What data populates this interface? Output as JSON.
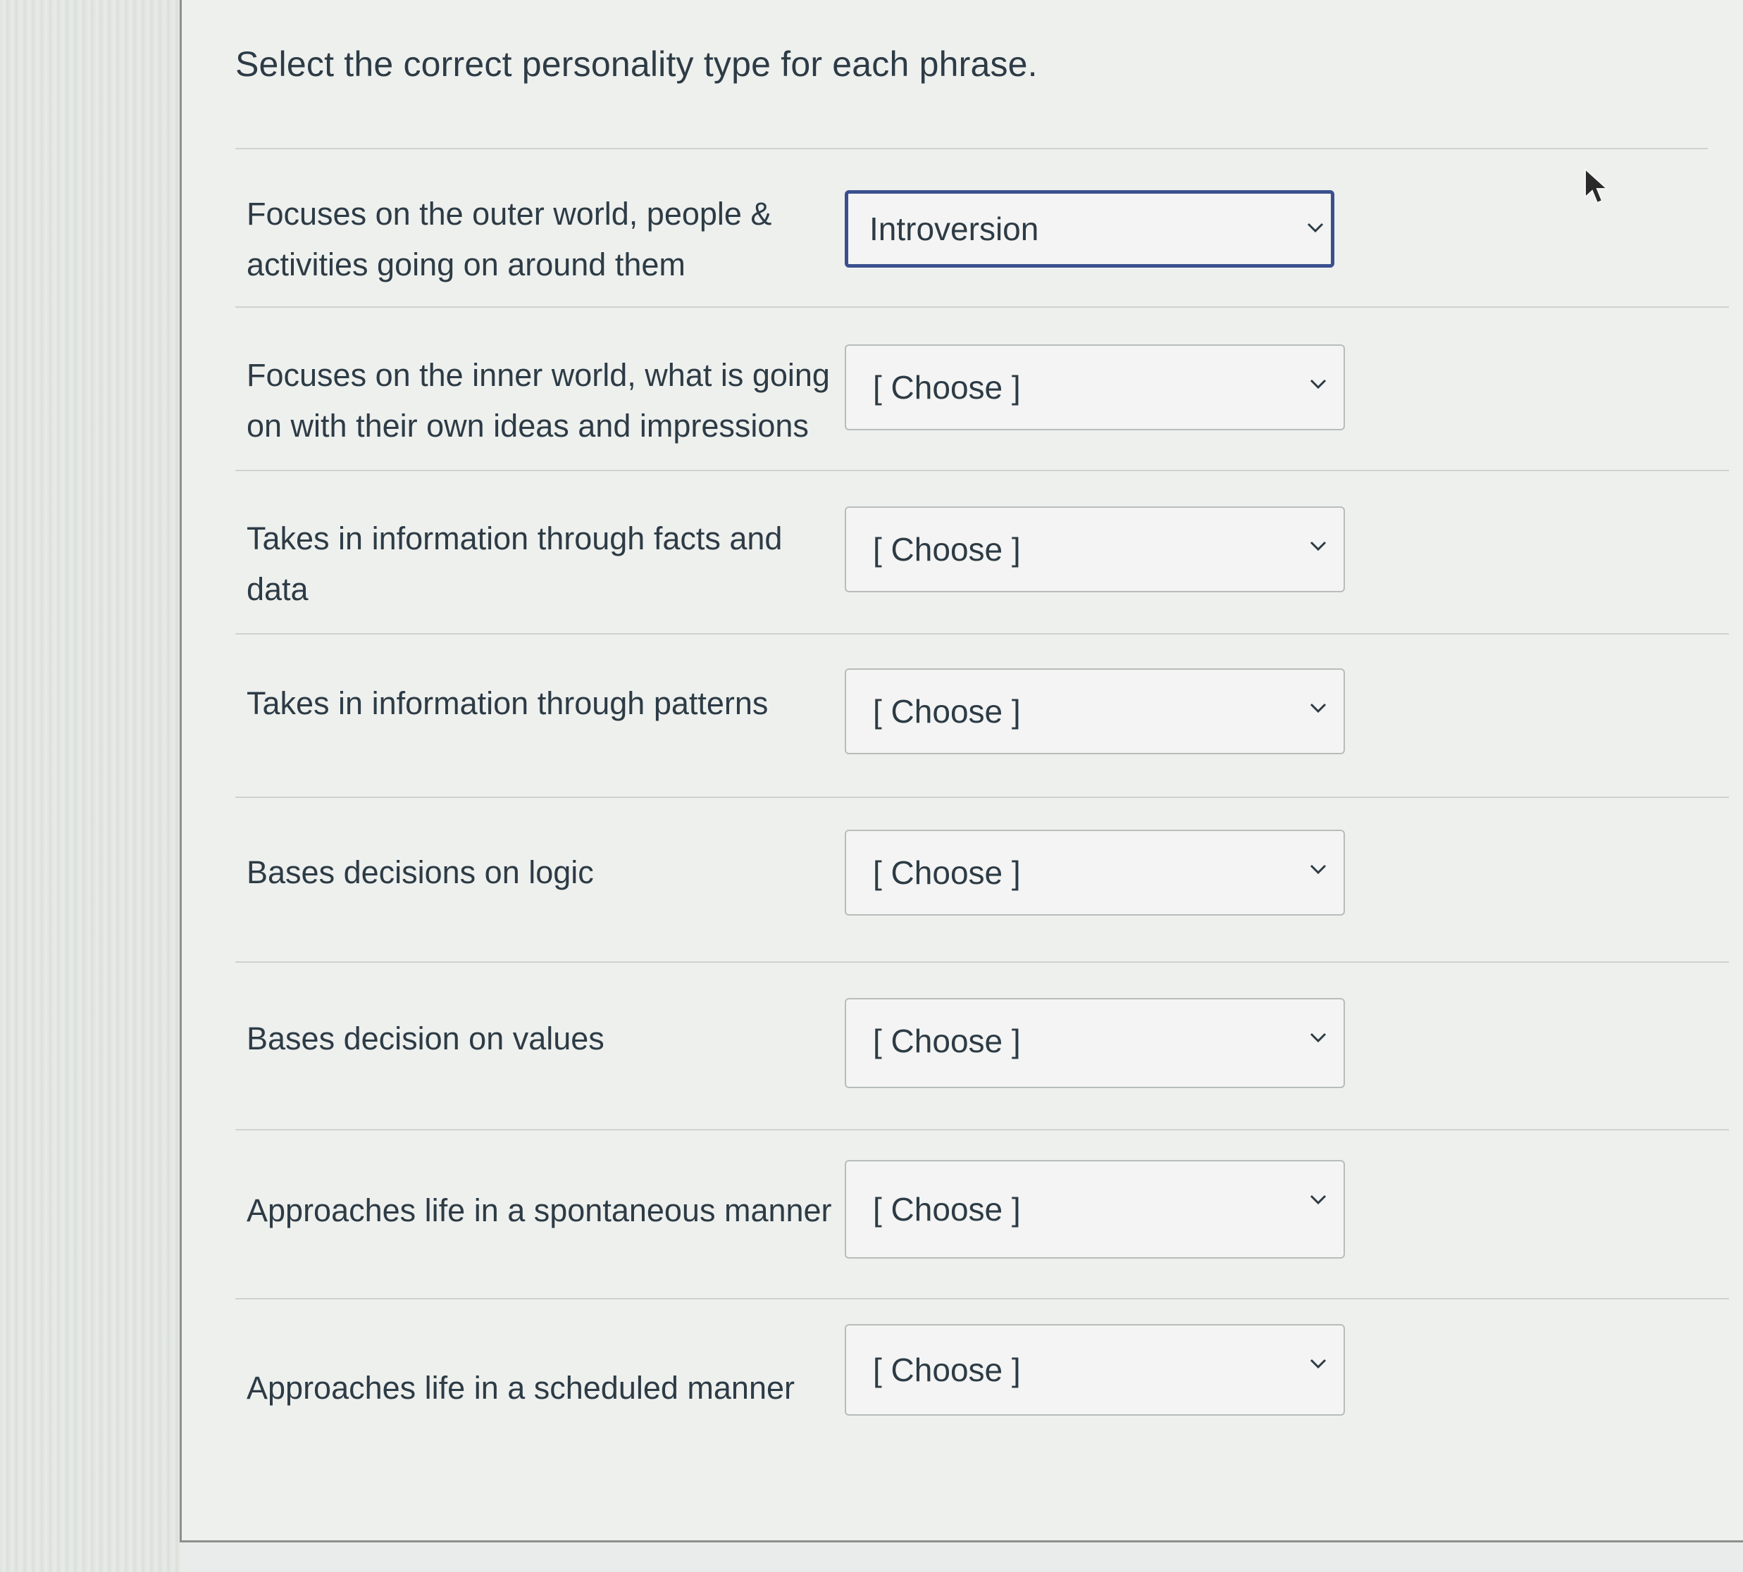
{
  "question": {
    "title": "Select the correct personality type for each phrase."
  },
  "rows": [
    {
      "phrase": "Focuses on the outer world, people & activities going on around them",
      "selected": "Introversion"
    },
    {
      "phrase": "Focuses on the inner world, what is going on with their own ideas and impressions",
      "selected": "[ Choose ]"
    },
    {
      "phrase": "Takes in information through facts and data",
      "selected": "[ Choose ]"
    },
    {
      "phrase": "Takes in information through patterns",
      "selected": "[ Choose ]"
    },
    {
      "phrase": "Bases decisions on logic",
      "selected": "[ Choose ]"
    },
    {
      "phrase": "Bases decision on values",
      "selected": "[ Choose ]"
    },
    {
      "phrase": "Approaches life in a spontaneous manner",
      "selected": "[ Choose ]"
    },
    {
      "phrase": "Approaches life in a scheduled manner",
      "selected": "[ Choose ]"
    }
  ],
  "icons": {
    "select_arrow": "chevron-down-icon",
    "mouse_cursor": "pointer-cursor-icon"
  },
  "colors": {
    "text": "#2d3b45",
    "focus_border": "#3b4f8f",
    "select_border": "#b8bdba",
    "divider": "#cfd3d0"
  }
}
